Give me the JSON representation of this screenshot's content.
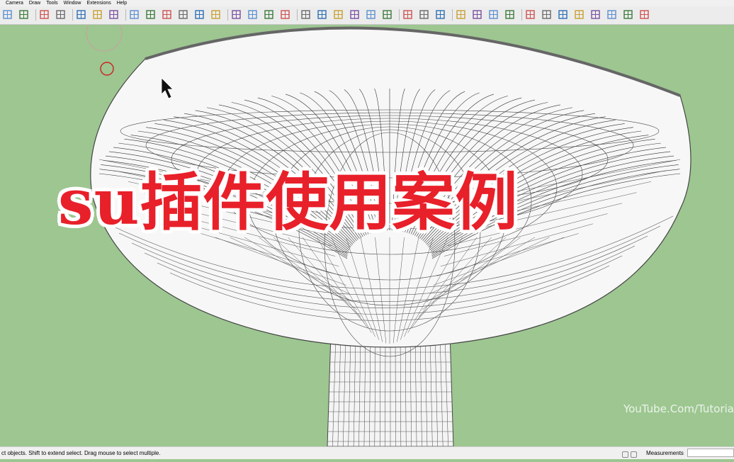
{
  "menu": {
    "items": [
      "Camera",
      "Draw",
      "Tools",
      "Window",
      "Extensions",
      "Help"
    ]
  },
  "toolbar": {
    "icons": [
      "prev-view-icon",
      "next-view-icon",
      "orbit-icon",
      "position-camera-icon",
      "select-icon",
      "make-group-icon",
      "make-component-icon",
      "align-icon",
      "align-center-icon",
      "align-right-icon",
      "line-icon",
      "add-point-icon",
      "remove-point-icon",
      "xray-icon",
      "wireframe-icon",
      "hidden-line-icon",
      "grid-icon",
      "section-icon",
      "texture-icon",
      "shaded-icon",
      "monochrome-icon",
      "edit-icon",
      "explode-icon",
      "minus-icon",
      "close-x-icon",
      "layer-icon",
      "pencil-icon",
      "front-view-icon",
      "speech-icon",
      "tag-icon",
      "circle-icon",
      "zoom-icon",
      "sphere-icon",
      "box-icon",
      "paint-icon",
      "highlighted-view-icon",
      "ruler-icon",
      "help-icon"
    ]
  },
  "overlay": {
    "title": "su插件使用案例"
  },
  "watermark": {
    "text": "YouTube.Com/Tutoria"
  },
  "status": {
    "hint": "ct objects. Shift to extend select. Drag mouse to select multiple.",
    "measurements_label": "Measurements",
    "measurements_value": ""
  },
  "colors": {
    "viewport_bg": "#9dc691",
    "title_red": "#e8202a"
  }
}
